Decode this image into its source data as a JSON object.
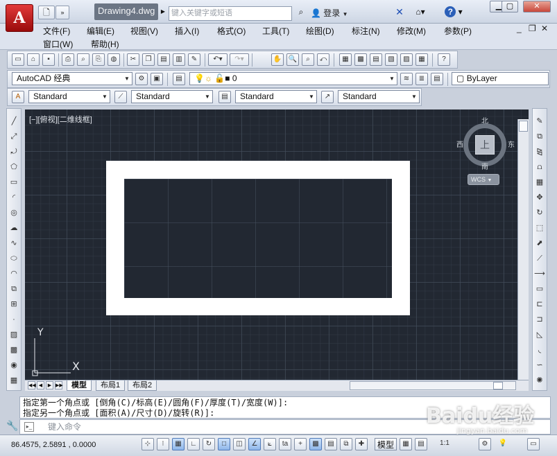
{
  "titlebar": {
    "document_name": "Drawing4.dwg",
    "search_placeholder": "键入关键字或短语",
    "login_label": "登录",
    "help_symbol": "?"
  },
  "menubar": {
    "items": [
      "文件(F)",
      "编辑(E)",
      "视图(V)",
      "插入(I)",
      "格式(O)",
      "工具(T)",
      "绘图(D)",
      "标注(N)",
      "修改(M)",
      "参数(P)"
    ],
    "items_row2": [
      "窗口(W)",
      "帮助(H)"
    ]
  },
  "toolbars": {
    "workspace": "AutoCAD 经典",
    "layer": "0",
    "color": "ByLayer",
    "text_style": "Standard",
    "dim_style": "Standard",
    "table_style": "Standard",
    "multileader_style": "Standard"
  },
  "viewport": {
    "label": "[−][俯视][二维线框]",
    "compass": {
      "north": "北",
      "south": "南",
      "east": "东",
      "west": "西",
      "face": "上"
    },
    "wcs_label": "WCS",
    "ucs_x": "X",
    "ucs_y": "Y"
  },
  "layout_tabs": [
    "模型",
    "布局1",
    "布局2"
  ],
  "command": {
    "history": [
      "指定第一个角点或 [倒角(C)/标高(E)/圆角(F)/厚度(T)/宽度(W)]:",
      "指定另一个角点或 [面积(A)/尺寸(D)/旋转(R)]:"
    ],
    "input_placeholder": "键入命令"
  },
  "statusbar": {
    "coordinates": "86.4575,  2.5891 , 0.0000",
    "model_label": "模型",
    "scale_label": "1:1"
  },
  "watermark": {
    "text": "Baidu经验",
    "sub": "jingyan.baidu.com"
  },
  "colors": {
    "canvas_bg": "#222832",
    "rectangle": "#ffffff",
    "app_button": "#c91d1d"
  }
}
